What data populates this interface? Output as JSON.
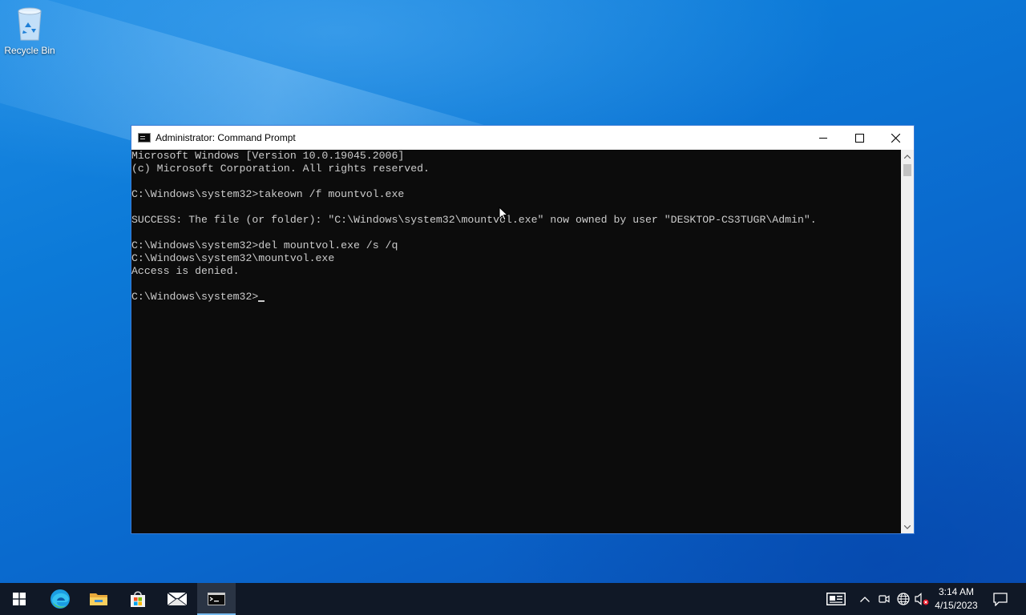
{
  "desktop": {
    "icons": [
      {
        "label": "Recycle Bin",
        "icon": "recycle-bin-icon"
      }
    ]
  },
  "window": {
    "title": "Administrator: Command Prompt",
    "icon": "cmd-icon",
    "controls": {
      "minimize": "minimize-icon",
      "maximize": "maximize-icon",
      "close": "close-icon"
    }
  },
  "console": {
    "lines": [
      "Microsoft Windows [Version 10.0.19045.2006]",
      "(c) Microsoft Corporation. All rights reserved.",
      "",
      "C:\\Windows\\system32>takeown /f mountvol.exe",
      "",
      "SUCCESS: The file (or folder): \"C:\\Windows\\system32\\mountvol.exe\" now owned by user \"DESKTOP-CS3TUGR\\Admin\".",
      "",
      "C:\\Windows\\system32>del mountvol.exe /s /q",
      "C:\\Windows\\system32\\mountvol.exe",
      "Access is denied.",
      ""
    ],
    "prompt": "C:\\Windows\\system32>",
    "text_color": "#cccccc",
    "background": "#0c0c0c"
  },
  "taskbar": {
    "apps": [
      {
        "name": "start",
        "icon": "windows-start-icon"
      },
      {
        "name": "edge",
        "icon": "edge-icon"
      },
      {
        "name": "file-explorer",
        "icon": "folder-icon"
      },
      {
        "name": "store",
        "icon": "store-icon"
      },
      {
        "name": "mail",
        "icon": "mail-icon"
      },
      {
        "name": "command-prompt",
        "icon": "cmd-icon",
        "active": true
      }
    ],
    "tray": [
      "news-icon",
      "chevron-up-icon",
      "meet-now-icon",
      "network-globe-icon",
      "volume-muted-icon"
    ],
    "clock": {
      "time": "3:14 AM",
      "date": "4/15/2023"
    },
    "notification_icon": "notification-icon",
    "accent": "#76b9ed"
  }
}
